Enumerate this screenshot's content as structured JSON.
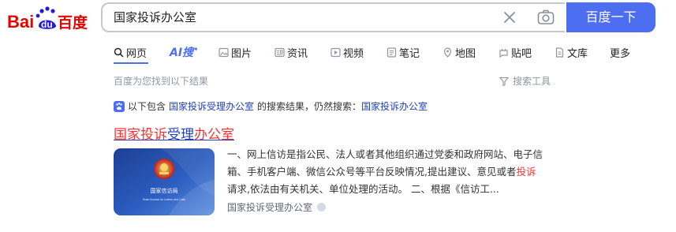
{
  "logo": {
    "text_left": "Bai",
    "text_paw": "du",
    "text_right": "百度"
  },
  "search": {
    "query": "国家投诉办公室",
    "button_label": "百度一下"
  },
  "tabs": [
    {
      "label": "网页",
      "icon": "search-icon",
      "active": true
    },
    {
      "label": "AI搜",
      "icon": "ai-search-icon",
      "active": false
    },
    {
      "label": "图片",
      "icon": "image-icon",
      "active": false
    },
    {
      "label": "资讯",
      "icon": "news-icon",
      "active": false
    },
    {
      "label": "视频",
      "icon": "video-icon",
      "active": false
    },
    {
      "label": "笔记",
      "icon": "note-icon",
      "active": false
    },
    {
      "label": "地图",
      "icon": "map-icon",
      "active": false
    },
    {
      "label": "贴吧",
      "icon": "tieba-icon",
      "active": false
    },
    {
      "label": "文库",
      "icon": "doc-icon",
      "active": false
    },
    {
      "label": "更多",
      "icon": "",
      "active": false
    }
  ],
  "results_hint": "百度为您找到以下结果",
  "search_tools_label": "搜索工具",
  "notice": {
    "prefix": "以下包含",
    "link_query": "国家投诉受理办公室",
    "middle": "的搜索结果，仍然搜索：",
    "original_query": "国家投诉办公室"
  },
  "result": {
    "title_parts": [
      {
        "text": "国家投诉",
        "highlight": true
      },
      {
        "text": "受理",
        "highlight": false
      },
      {
        "text": "办公室",
        "highlight": true
      }
    ],
    "thumbnail_caption": "国家信访局",
    "thumbnail_subcaption": "State Bureau for Letters and Calls",
    "abstract_lines": [
      {
        "text": "一、网上信访是指公民、法人或者其他组织通过党委和政府网站、电子信",
        "hl": ""
      },
      {
        "text": "箱、手机客户端、微信公众号等平台反映情况,提出建议、意见或者",
        "hl": "投诉"
      },
      {
        "text": "请求,依法由有关机关、单位处理的活动。 二、根据《信访工...",
        "hl": ""
      }
    ],
    "source": "国家投诉受理办公室"
  },
  "colors": {
    "accent": "#4e6ef2",
    "link": "#2440b3",
    "highlight": "#f73131",
    "logo_red": "#e10602",
    "logo_blue": "#2319dc"
  }
}
